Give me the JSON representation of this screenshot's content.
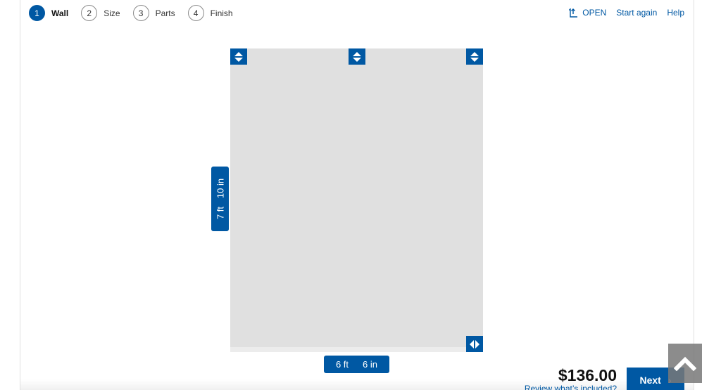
{
  "steps": [
    {
      "number": "1",
      "label": "Wall",
      "active": true
    },
    {
      "number": "2",
      "label": "Size",
      "active": false
    },
    {
      "number": "3",
      "label": "Parts",
      "active": false
    },
    {
      "number": "4",
      "label": "Finish",
      "active": false
    }
  ],
  "top_links": {
    "open": "OPEN",
    "start_again": "Start again",
    "help": "Help"
  },
  "dimensions": {
    "height_ft": "7 ft",
    "height_in": "10 in",
    "width_ft": "6 ft",
    "width_in": "6 in"
  },
  "footer": {
    "price": "$136.00",
    "review": "Review what’s included?",
    "next": "Next"
  },
  "icons": {
    "open": "open-icon",
    "resize_vertical": "up-down-arrows-icon",
    "resize_horizontal": "left-right-arrows-icon",
    "next": "chevron-right-icon",
    "scroll_top": "chevron-up-icon"
  },
  "colors": {
    "accent": "#0058a3",
    "wall": "#e0e0e0"
  }
}
